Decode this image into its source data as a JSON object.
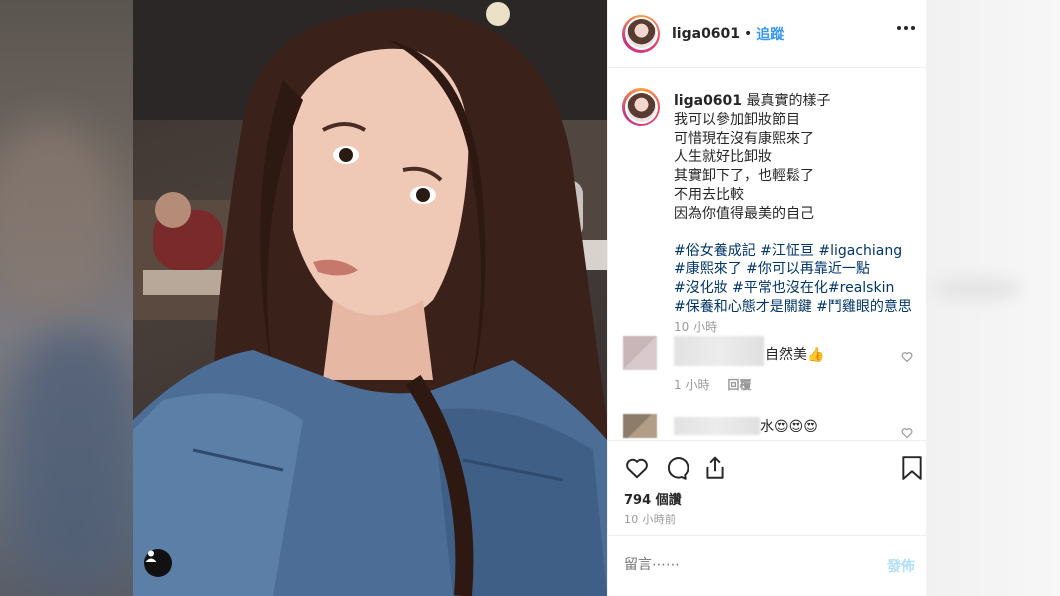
{
  "post": {
    "username": "liga0601",
    "separator": "•",
    "follow_label": "追蹤",
    "more_icon": "more-horizontal-icon"
  },
  "caption": {
    "username": "liga0601",
    "lines": [
      "最真實的樣子",
      "我可以參加卸妝節目",
      "可惜現在沒有康熙來了",
      "人生就好比卸妝",
      "其實卸下了，也輕鬆了",
      "不用去比較",
      "因為你值得最美的自己"
    ],
    "hashtags": [
      "#俗女養成記 #江怔亘 #ligachiang",
      "#康熙來了 #你可以再靠近一點",
      "#沒化妝 #平常也沒在化#realskin",
      "#保養和心態才是關鍵 #鬥雞眼的意思"
    ],
    "time": "10 小時"
  },
  "comments": [
    {
      "text": "自然美👍",
      "time": "1 小時",
      "reply_label": "回覆"
    },
    {
      "text": "水😍😍😍"
    }
  ],
  "actions": {
    "like_icon": "heart-icon",
    "comment_icon": "comment-icon",
    "share_icon": "share-icon",
    "save_icon": "bookmark-icon"
  },
  "stats": {
    "views": "794 個讚",
    "posted": "10 小時前"
  },
  "comment_box": {
    "placeholder": "留言⋯⋯",
    "post_label": "發佈"
  },
  "colors": {
    "link": "#3897f0",
    "hashtag": "#003569",
    "muted": "#999999",
    "post_disabled": "#b2dffc"
  }
}
